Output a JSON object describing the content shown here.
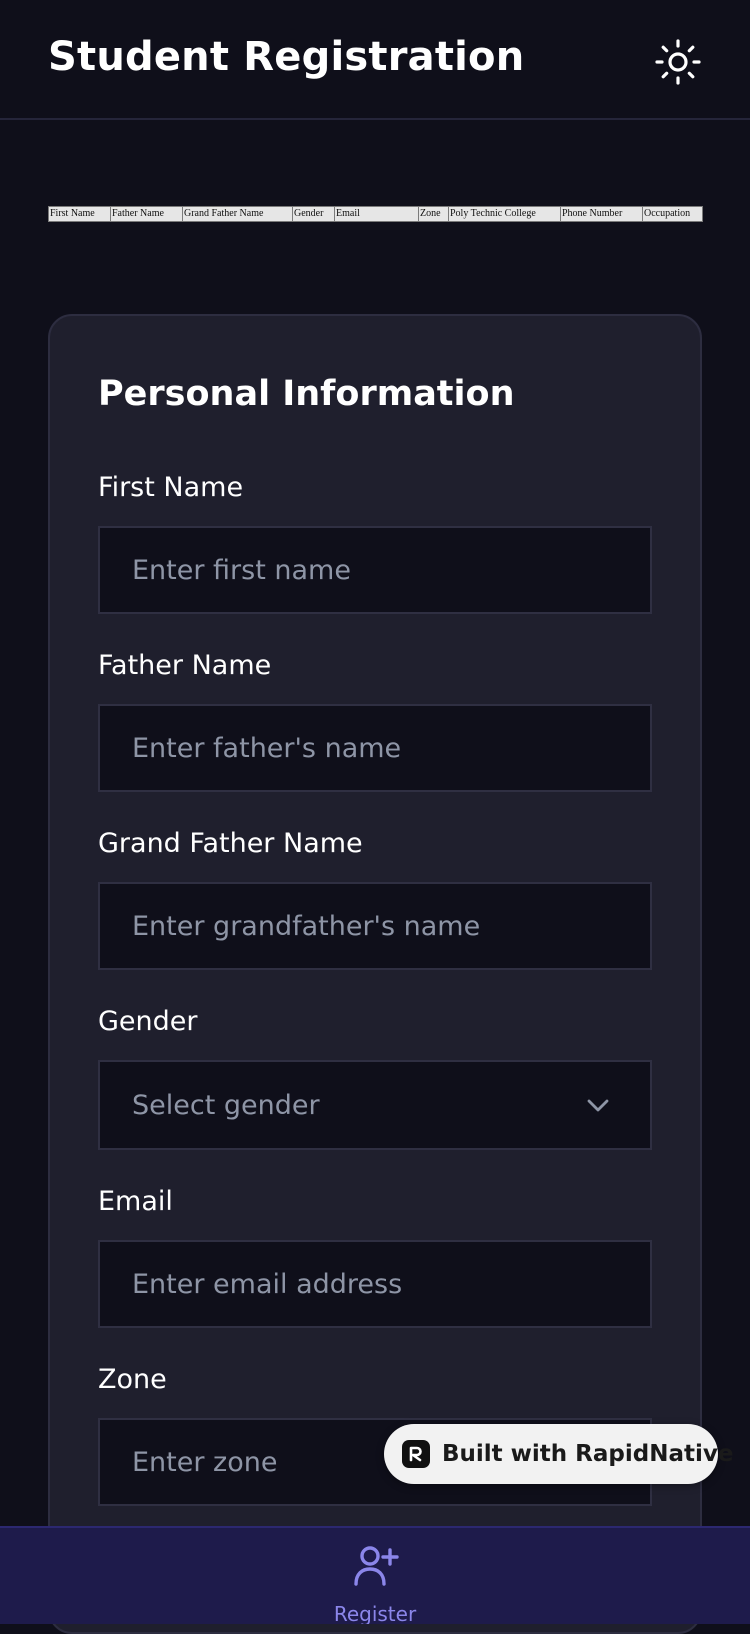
{
  "header": {
    "title": "Student Registration",
    "theme_icon": "sun-icon"
  },
  "legacy_table": {
    "columns": [
      "First Name",
      "Father Name",
      "Grand Father Name",
      "Gender",
      "Email",
      "Zone",
      "Poly Technic College",
      "Phone Number",
      "Occupation"
    ]
  },
  "form": {
    "section_title": "Personal Information",
    "fields": [
      {
        "label": "First Name",
        "placeholder": "Enter first name",
        "value": ""
      },
      {
        "label": "Father Name",
        "placeholder": "Enter father's name",
        "value": ""
      },
      {
        "label": "Grand Father Name",
        "placeholder": "Enter grandfather's name",
        "value": ""
      },
      {
        "label": "Gender",
        "placeholder": "Select gender",
        "value": ""
      },
      {
        "label": "Email",
        "placeholder": "Enter email address",
        "value": ""
      },
      {
        "label": "Zone",
        "placeholder": "Enter zone",
        "value": ""
      }
    ]
  },
  "badge": {
    "text": "Built with RapidNative"
  },
  "bottom_nav": {
    "items": [
      {
        "label": "Register",
        "icon": "user-plus-icon",
        "active": true
      }
    ]
  },
  "colors": {
    "background": "#0f0f1a",
    "card": "#1f1f2d",
    "nav_background": "#1e1b4b",
    "accent": "#8b86ea",
    "placeholder": "#8e95a6"
  }
}
